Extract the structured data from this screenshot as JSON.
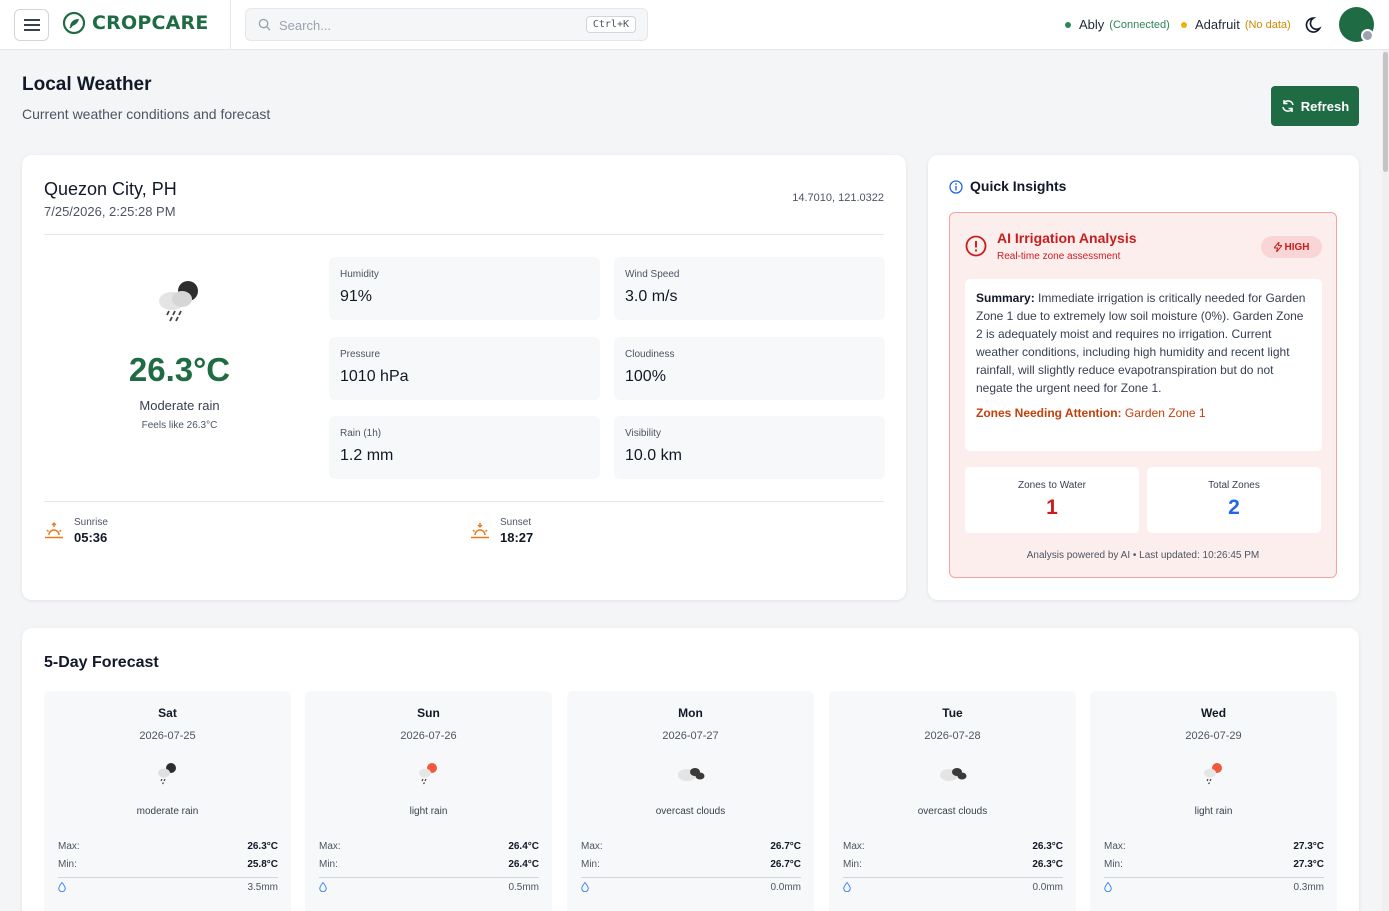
{
  "topbar": {
    "brand": "CROPCARE",
    "search_placeholder": "Search...",
    "search_shortcut": "Ctrl+K",
    "ably": {
      "name": "Ably",
      "status": "(Connected)",
      "dot_color": "#2f855a"
    },
    "adafruit": {
      "name": "Adafruit",
      "status": "(No data)",
      "dot_color": "#eab308"
    }
  },
  "header": {
    "title": "Local Weather",
    "subtitle": "Current weather conditions and forecast",
    "refresh_label": "Refresh"
  },
  "weather": {
    "city": "Quezon City, PH",
    "datetime": "7/25/2026, 2:25:28 PM",
    "coords": "14.7010, 121.0322",
    "temp": "26.3°C",
    "description": "Moderate rain",
    "feels_like": "Feels like 26.3°C",
    "stats": [
      {
        "label": "Humidity",
        "value": "91%"
      },
      {
        "label": "Wind Speed",
        "value": "3.0 m/s"
      },
      {
        "label": "Pressure",
        "value": "1010 hPa"
      },
      {
        "label": "Cloudiness",
        "value": "100%"
      },
      {
        "label": "Rain (1h)",
        "value": "1.2 mm"
      },
      {
        "label": "Visibility",
        "value": "10.0 km"
      }
    ],
    "sunrise": {
      "label": "Sunrise",
      "value": "05:36"
    },
    "sunset": {
      "label": "Sunset",
      "value": "18:27"
    }
  },
  "insights": {
    "title": "Quick Insights",
    "ai_title": "AI Irrigation Analysis",
    "ai_subtitle": "Real-time zone assessment",
    "priority": "HIGH",
    "summary_label": "Summary:",
    "summary_text": "Immediate irrigation is critically needed for Garden Zone 1 due to extremely low soil moisture (0%). Garden Zone 2 is adequately moist and requires no irrigation. Current weather conditions, including high humidity and recent light rainfall, will slightly reduce evapotranspiration but do not negate the urgent need for Zone 1.",
    "attention_label": "Zones Needing Attention:",
    "attention_value": "Garden Zone 1",
    "zones_to_water": {
      "label": "Zones to Water",
      "value": "1"
    },
    "total_zones": {
      "label": "Total Zones",
      "value": "2"
    },
    "powered": "Analysis powered by AI • Last updated: 10:26:45 PM"
  },
  "forecast": {
    "title": "5-Day Forecast",
    "max_label": "Max:",
    "min_label": "Min:",
    "days": [
      {
        "day": "Sat",
        "date": "2026-07-25",
        "desc": "moderate rain",
        "icon": "moderate-rain-icon",
        "max": "26.3°C",
        "min": "25.8°C",
        "rain": "3.5mm"
      },
      {
        "day": "Sun",
        "date": "2026-07-26",
        "desc": "light rain",
        "icon": "light-rain-icon",
        "max": "26.4°C",
        "min": "26.4°C",
        "rain": "0.5mm"
      },
      {
        "day": "Mon",
        "date": "2026-07-27",
        "desc": "overcast clouds",
        "icon": "overcast-clouds-icon",
        "max": "26.7°C",
        "min": "26.7°C",
        "rain": "0.0mm"
      },
      {
        "day": "Tue",
        "date": "2026-07-28",
        "desc": "overcast clouds",
        "icon": "overcast-clouds-icon",
        "max": "26.3°C",
        "min": "26.3°C",
        "rain": "0.0mm"
      },
      {
        "day": "Wed",
        "date": "2026-07-29",
        "desc": "light rain",
        "icon": "light-rain-icon",
        "max": "27.3°C",
        "min": "27.3°C",
        "rain": "0.3mm"
      }
    ]
  }
}
